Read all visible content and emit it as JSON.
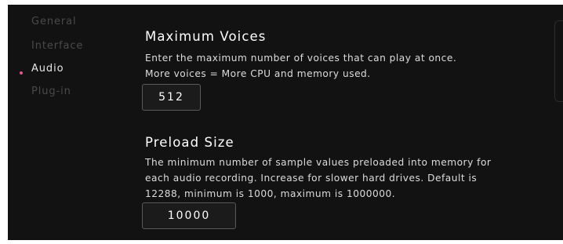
{
  "sidebar": {
    "items": [
      {
        "label": "General",
        "active": false
      },
      {
        "label": "Interface",
        "active": false
      },
      {
        "label": "Audio",
        "active": true
      },
      {
        "label": "Plug-in",
        "active": false
      }
    ],
    "active_indicator_color": "#e0568f"
  },
  "main": {
    "max_voices": {
      "title": "Maximum Voices",
      "desc_lines": [
        "Enter the maximum number of voices that can play at once.",
        "More voices = More CPU and memory used."
      ],
      "value": "512"
    },
    "preload_size": {
      "title": "Preload Size",
      "desc_lines": [
        "The minimum number of sample values preloaded into memory for",
        "each audio recording. Increase for slower hard drives. Default is",
        "12288, minimum is 1000, maximum is 1000000."
      ],
      "value": "10000"
    }
  },
  "colors": {
    "background": "#121212",
    "text_primary": "#ffffff",
    "text_muted": "#4a4a4a",
    "field_border": "#5a5a5a"
  }
}
